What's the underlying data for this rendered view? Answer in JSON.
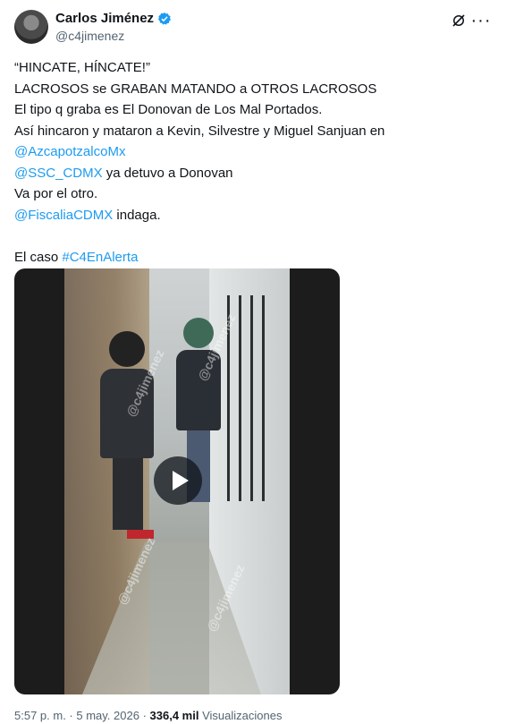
{
  "author": {
    "name": "Carlos Jiménez",
    "handle": "@c4jimenez"
  },
  "tweet_lines": [
    "“HINCATE, HÍNCATE!”",
    "LACROSOS se GRABAN MATANDO a OTROS LACROSOS",
    "El tipo q graba es El Donovan de Los Mal Portados.",
    "Así hincaron y mataron a Kevin, Silvestre y Miguel Sanjuan en"
  ],
  "mention1": "@AzcapotzalcoMx",
  "mention2": "@SSC_CDMX",
  "mention2_after": " ya detuvo a Donovan",
  "line_va": "Va por el otro.",
  "mention3": "@FiscaliaCDMX",
  "mention3_after": " indaga.",
  "caso_prefix": "El caso ",
  "hashtag": "#C4EnAlerta",
  "media": {
    "watermark": "@c4jimenez"
  },
  "meta": {
    "time": "5:57 p. m.",
    "date": "5 may. 2026",
    "sep": " · ",
    "views": "336,4 mil",
    "views_label": "Visualizaciones"
  },
  "colors": {
    "link": "#1d9bf0",
    "verified": "#1d9bf0"
  }
}
